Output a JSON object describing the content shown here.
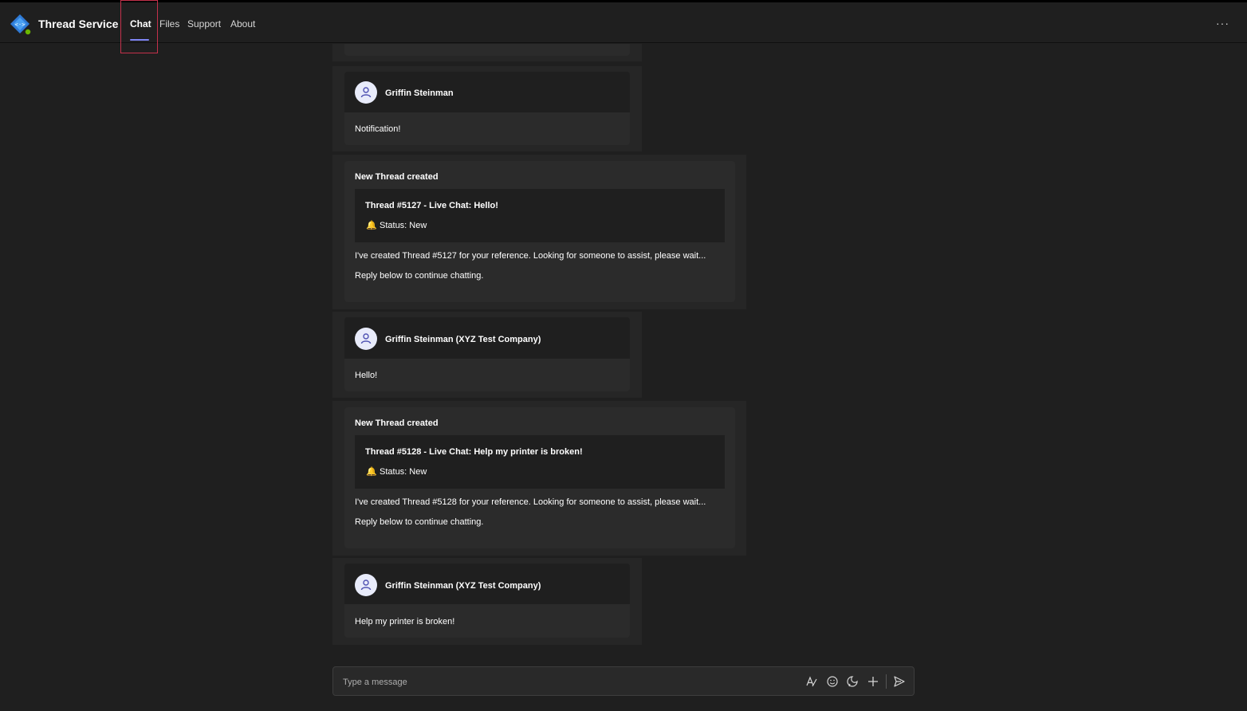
{
  "header": {
    "app_title": "Thread Service",
    "tabs": [
      {
        "label": "Chat",
        "active": true
      },
      {
        "label": "Files",
        "active": false
      },
      {
        "label": "Support",
        "active": false
      },
      {
        "label": "About",
        "active": false
      }
    ],
    "more_label": "···"
  },
  "messages": [
    {
      "type": "user",
      "sender": "Griffin Steinman",
      "text": "Notification!"
    },
    {
      "type": "bot",
      "heading": "New Thread created",
      "thread_title": "Thread #5127 - Live Chat: Hello!",
      "status_icon": "🔔",
      "status": "Status: New",
      "line1": "I've created Thread #5127 for your reference. Looking for someone to assist, please wait...",
      "line2": "Reply below to continue chatting."
    },
    {
      "type": "user",
      "sender": "Griffin Steinman (XYZ Test Company)",
      "text": "Hello!"
    },
    {
      "type": "bot",
      "heading": "New Thread created",
      "thread_title": "Thread #5128 - Live Chat: Help my printer is broken!",
      "status_icon": "🔔",
      "status": "Status: New",
      "line1": "I've created Thread #5128 for your reference. Looking for someone to assist, please wait...",
      "line2": "Reply below to continue chatting."
    },
    {
      "type": "user",
      "sender": "Griffin Steinman (XYZ Test Company)",
      "text": "Help my printer is broken!"
    }
  ],
  "compose": {
    "placeholder": "Type a message",
    "icons": [
      "format-icon",
      "emoji-icon",
      "sticker-icon",
      "attach-plus-icon",
      "send-icon"
    ]
  },
  "colors": {
    "background": "#1f1f1f",
    "card": "#2b2b2b",
    "accent": "#7f85f5",
    "focus_outline": "#c4314b"
  }
}
